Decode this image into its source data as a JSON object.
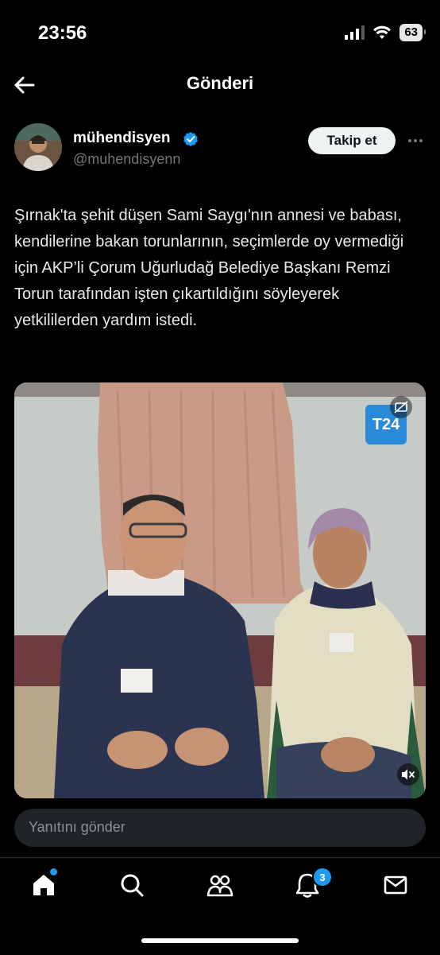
{
  "status_bar": {
    "time": "23:56",
    "battery": "63"
  },
  "header": {
    "title": "Gönderi",
    "back_icon": "arrow-left-icon"
  },
  "author": {
    "name": "mühendisyen",
    "handle": "@muhendisyenn",
    "verified": true,
    "follow_label": "Takip et"
  },
  "tweet": {
    "text": "Şırnak'ta şehit düşen Sami Saygı'nın annesi ve babası, kendilerine bakan torunlarının, seçimlerde oy vermediği için AKP’li Çorum Uğurludağ Belediye Başkanı Remzi Torun tarafından işten çıkartıldığını söyleyerek yetkililerden yardım istedi."
  },
  "media": {
    "watermark": "T24",
    "mute_icon": "speaker-muted-icon",
    "captions_icon": "cc-icon"
  },
  "reply": {
    "placeholder": "Yanıtını gönder"
  },
  "nav": {
    "items": [
      "home-icon",
      "search-icon",
      "communities-icon",
      "notifications-icon",
      "messages-icon"
    ],
    "notifications_badge": "3"
  },
  "colors": {
    "accent": "#1d9bf0",
    "background": "#000000"
  }
}
